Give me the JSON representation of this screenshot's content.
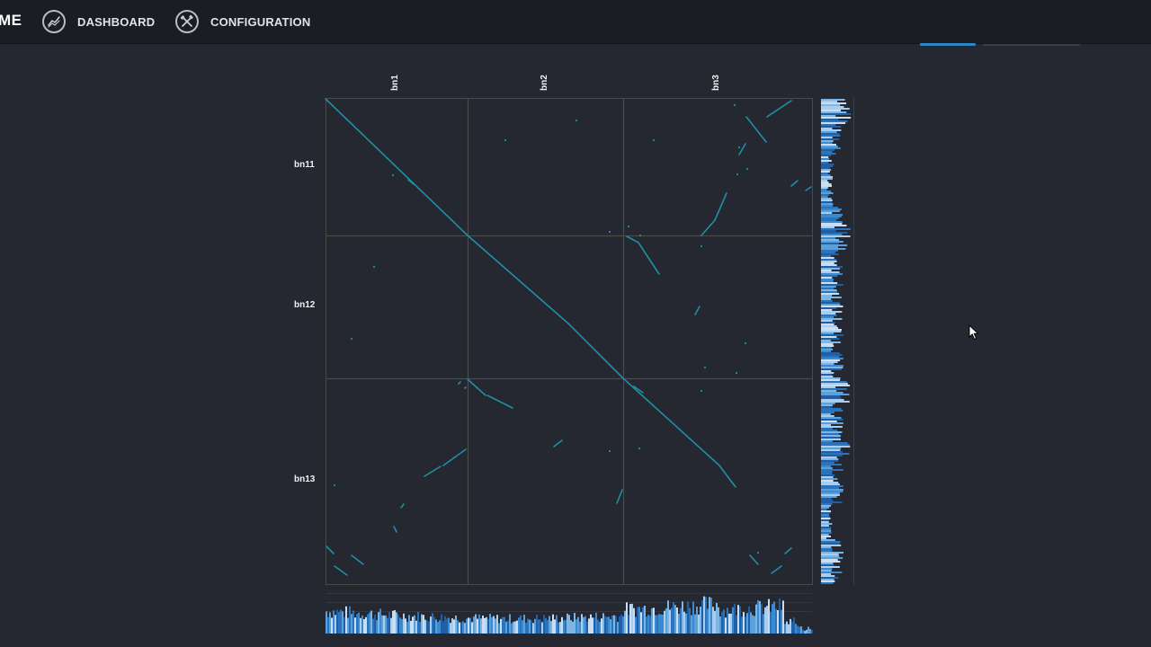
{
  "nav": {
    "brand": "ME",
    "items": [
      {
        "label": "DASHBOARD",
        "icon": "chart-line-icon"
      },
      {
        "label": "CONFIGURATION",
        "icon": "tools-icon"
      }
    ]
  },
  "plot": {
    "top_labels": [
      "bn1",
      "bn2",
      "bn3"
    ],
    "left_labels": [
      "bn11",
      "bn12",
      "bn13"
    ]
  },
  "colors": {
    "background": "#252831",
    "navbar": "#1b1d24",
    "dot": "#1f8fa3",
    "grid": "#4a4a47",
    "histogram": "#2f86c6",
    "accent": "#2f86c6"
  }
}
